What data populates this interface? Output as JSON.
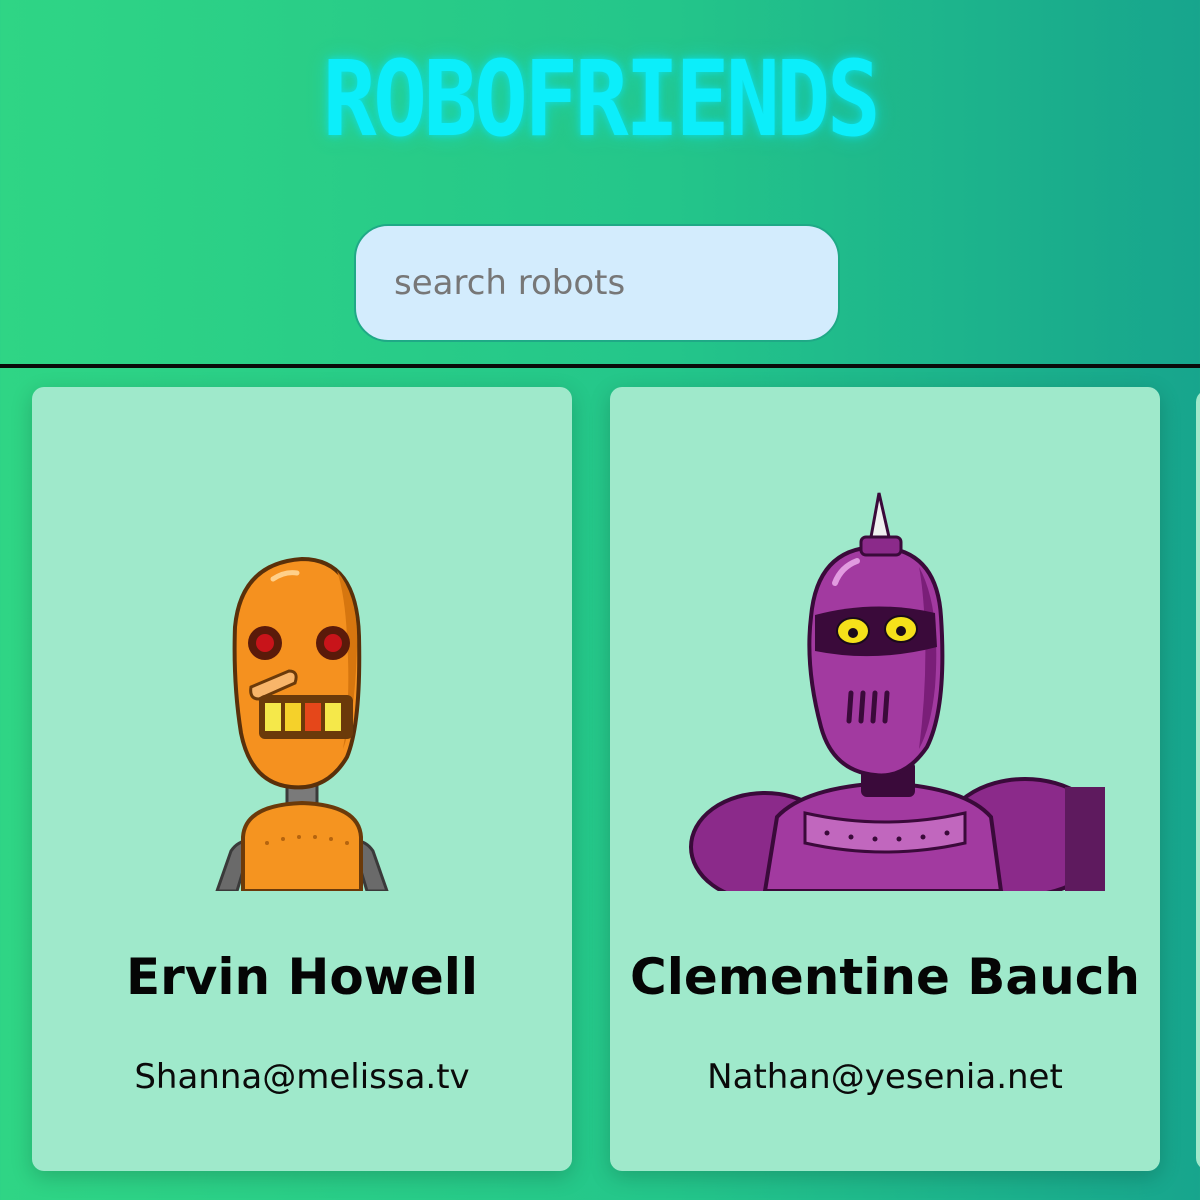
{
  "header": {
    "title": "ROBOFRIENDS"
  },
  "search": {
    "placeholder": "search robots",
    "value": ""
  },
  "robots": [
    {
      "name": "Ervin Howell",
      "email": "Shanna@melissa.tv",
      "avatar": "orange-robot-avatar"
    },
    {
      "name": "Clementine Bauch",
      "email": "Nathan@yesenia.net",
      "avatar": "purple-robot-avatar"
    }
  ],
  "colors": {
    "title": "#0ceefa",
    "card_background": "#9fe9cb",
    "search_background": "#d3ecfd",
    "page_gradient_start": "#2fd585",
    "page_gradient_end": "#17a58d"
  }
}
